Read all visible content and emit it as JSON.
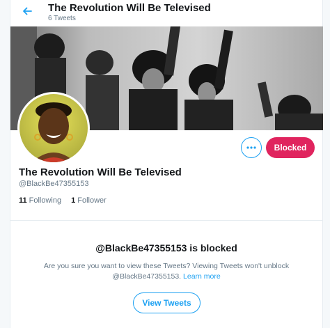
{
  "header": {
    "title": "The Revolution Will Be Televised",
    "tweet_count": "6 Tweets"
  },
  "profile": {
    "display_name": "The Revolution Will Be Televised",
    "handle": "@BlackBe47355153",
    "following_count": "11",
    "following_label": "Following",
    "follower_count": "1",
    "follower_label": "Follower"
  },
  "actions": {
    "blocked_label": "Blocked"
  },
  "blocked_notice": {
    "title": "@BlackBe47355153 is blocked",
    "message_line1": "Are you sure you want to view these Tweets? Viewing Tweets won't unblock",
    "message_handle": "@BlackBe47355153.",
    "learn_more": "Learn more",
    "view_button": "View Tweets"
  },
  "colors": {
    "accent": "#1da1f2",
    "blocked": "#e0245e",
    "text": "#14171a",
    "muted": "#657786"
  },
  "icons": {
    "back": "arrow-left-icon",
    "more": "more-horizontal-icon"
  }
}
